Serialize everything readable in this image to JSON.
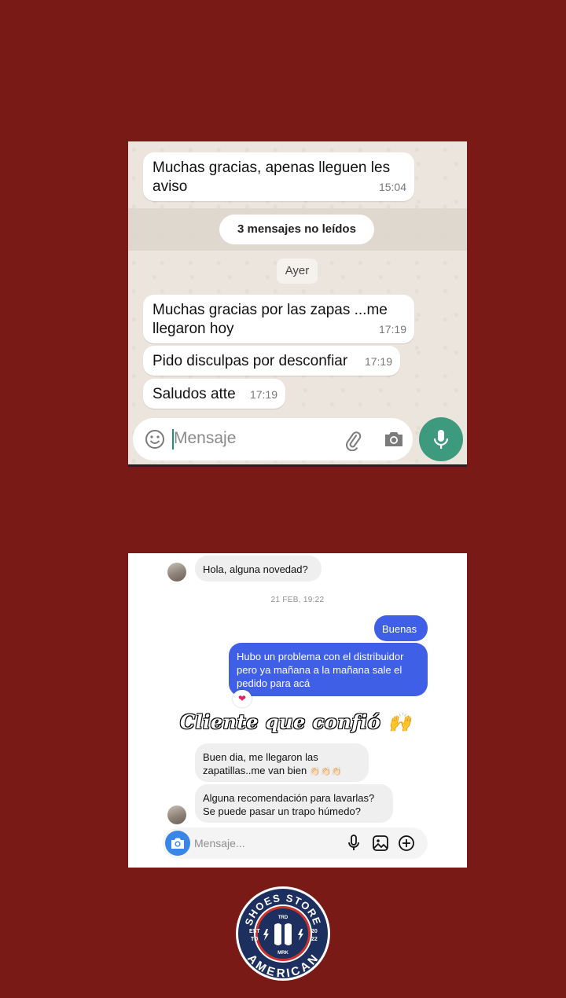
{
  "whatsapp": {
    "messages": [
      {
        "text_line1": "Muchas gracias,  apenas lleguen les",
        "text_line2": "aviso",
        "time": "15:04"
      },
      {
        "text_line1": "Muchas gracias por las zapas ...me",
        "text_line2": "llegaron hoy",
        "time": "17:19"
      },
      {
        "text": "Pido disculpas por desconfiar",
        "time": "17:19"
      },
      {
        "text": "Saludos atte",
        "time": "17:19"
      }
    ],
    "unread_label": "3 mensajes no leídos",
    "date_label": "Ayer",
    "input_placeholder": "Mensaje",
    "icons": [
      "emoji-icon",
      "attach-icon",
      "camera-icon",
      "microphone-icon"
    ],
    "colors": {
      "accent": "#3d9a7c",
      "chat_bg": "#ece5dd"
    }
  },
  "instagram": {
    "message_in_1": "Hola, alguna novedad?",
    "date_label": "21 FEB, 19:22",
    "message_out_1": "Buenas",
    "message_out_2_line1": "Hubo un problema con el distribuidor",
    "message_out_2_line2": "pero ya mañana a la mañana sale el",
    "message_out_2_line3": "pedido para acá",
    "reaction": "❤",
    "caption": "Cliente que confió",
    "caption_emoji": "🙌",
    "message_in_2_line1": "Buen dia, me llegaron las",
    "message_in_2_line2": "zapatillas..me van bien",
    "message_in_2_emoji": "👏🏻👏🏻👏🏻",
    "message_in_3_line1": "Alguna recomendación para lavarlas?",
    "message_in_3_line2": "Se puede pasar un trapo húmedo?",
    "input_placeholder": "Mensaje...",
    "colors": {
      "outgoing_bubble": "#3f5fe6",
      "camera_button": "#3a86e8"
    }
  },
  "logo": {
    "top_text": "SHOES STORE",
    "bottom_text": "AMERICAN",
    "trd": "TRD",
    "mrk": "MRK",
    "est": "EST",
    "td": "TD",
    "year_top": "20",
    "year_bottom": "22",
    "colors": {
      "navy": "#1d2f5e",
      "red": "#c8322b"
    }
  }
}
